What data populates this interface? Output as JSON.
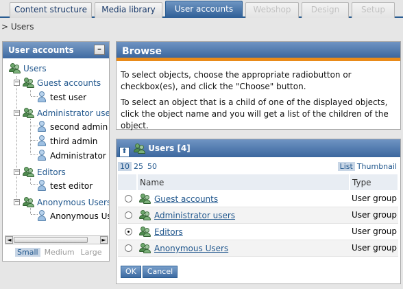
{
  "tabs": [
    {
      "label": "Content structure"
    },
    {
      "label": "Media library"
    },
    {
      "label": "User accounts"
    },
    {
      "label": "Webshop"
    },
    {
      "label": "Design"
    },
    {
      "label": "Setup"
    }
  ],
  "breadcrumb": "> Users",
  "left_panel": {
    "title": "User accounts",
    "minimize_label": "–",
    "tree": {
      "root": "Users",
      "items": [
        "Guest accounts",
        "test user",
        "Administrator users",
        "second admin",
        "third admin",
        "Administrator User",
        "Editors",
        "test editor",
        "Anonymous Users",
        "Anonymous User"
      ]
    },
    "scroll_left": "◄",
    "scroll_right": "►",
    "sizes": [
      "Small",
      "Medium",
      "Large"
    ]
  },
  "browse": {
    "title": "Browse",
    "paragraph1": "To select objects, choose the appropriate radiobutton or checkbox(es), and click the \"Choose\" button.",
    "paragraph2": "To select an object that is a child of one of the displayed objects, click the object name and you will get a list of the children of the object."
  },
  "list": {
    "up_icon": "⬆",
    "title": "Users [4]",
    "page_sizes": [
      "10",
      "25",
      "50"
    ],
    "views": [
      "List",
      "Thumbnail"
    ],
    "columns": [
      "Name",
      "Type"
    ],
    "rows": [
      {
        "name": "Guest accounts",
        "type": "User group"
      },
      {
        "name": "Administrator users",
        "type": "User group"
      },
      {
        "name": "Editors",
        "type": "User group"
      },
      {
        "name": "Anonymous Users",
        "type": "User group"
      }
    ],
    "ok_label": "OK",
    "cancel_label": "Cancel"
  }
}
